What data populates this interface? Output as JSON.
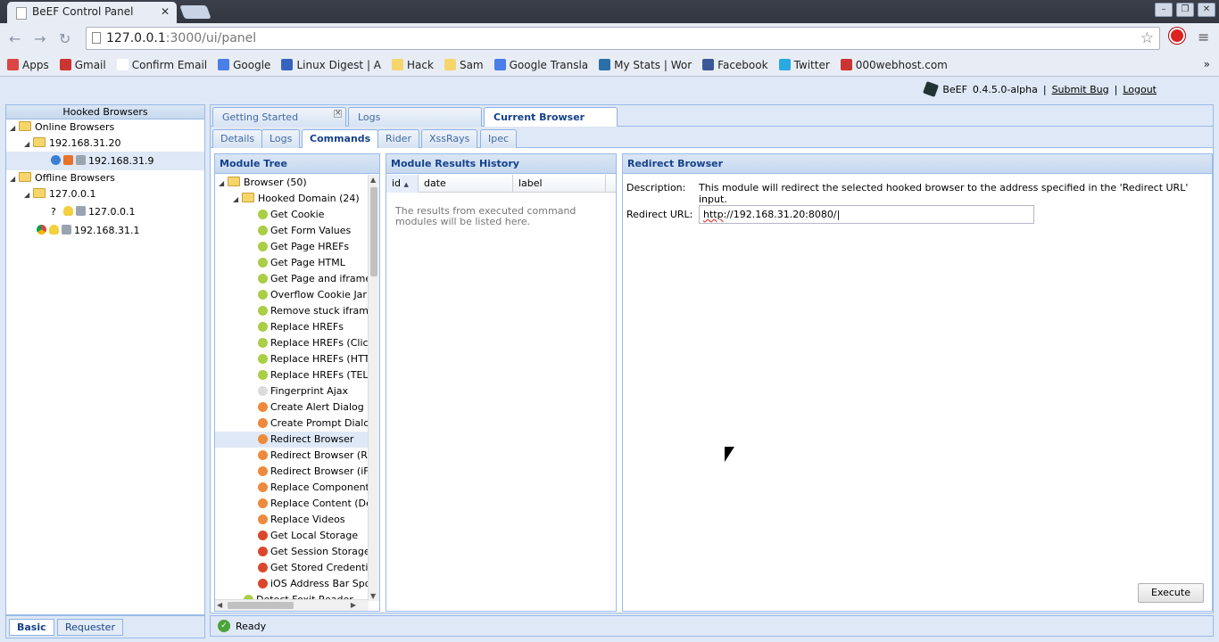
{
  "browser": {
    "tab_title": "BeEF Control Panel",
    "url_main": "127.0.0.1",
    "url_rest": ":3000/ui/panel",
    "bookmarks": [
      {
        "label": "Apps",
        "color": "#d44"
      },
      {
        "label": "Gmail",
        "color": "#c33"
      },
      {
        "label": "Confirm Email",
        "color": "#fff"
      },
      {
        "label": "Google",
        "color": "#4a7ee8"
      },
      {
        "label": "Linux Digest | A",
        "color": "#3763c0"
      },
      {
        "label": "Hack",
        "color": "#f6d56a"
      },
      {
        "label": "Sam",
        "color": "#f6d56a"
      },
      {
        "label": "Google Transla",
        "color": "#4a7ee8"
      },
      {
        "label": "My Stats | Wor",
        "color": "#2b6fa8"
      },
      {
        "label": "Facebook",
        "color": "#3b5998"
      },
      {
        "label": "Twitter",
        "color": "#29a9e1"
      },
      {
        "label": "000webhost.com",
        "color": "#c33"
      }
    ]
  },
  "topnav": {
    "brand": "BeEF",
    "version": "0.4.5.0-alpha",
    "submit_bug": "Submit Bug",
    "logout": "Logout"
  },
  "hooked": {
    "title": "Hooked Browsers",
    "online_label": "Online Browsers",
    "online_host": "192.168.31.20",
    "online_browser": "192.168.31.9",
    "offline_label": "Offline Browsers",
    "offline_host": "127.0.0.1",
    "offline_browser_1": "127.0.0.1",
    "offline_browser_1_icon": "?",
    "offline_browser_2": "192.168.31.1"
  },
  "bottom_tabs": {
    "basic": "Basic",
    "requester": "Requester"
  },
  "main_tabs": {
    "getting_started": "Getting Started",
    "logs": "Logs",
    "current_browser": "Current Browser"
  },
  "sub_tabs": {
    "details": "Details",
    "logs": "Logs",
    "commands": "Commands",
    "rider": "Rider",
    "xssrays": "XssRays",
    "ipec": "Ipec"
  },
  "module_tree": {
    "title": "Module Tree",
    "browser_folder": "Browser (50)",
    "hooked_domain_folder": "Hooked Domain (24)",
    "items": [
      {
        "label": "Get Cookie",
        "color": "#a8cf45"
      },
      {
        "label": "Get Form Values",
        "color": "#a8cf45"
      },
      {
        "label": "Get Page HREFs",
        "color": "#a8cf45"
      },
      {
        "label": "Get Page HTML",
        "color": "#a8cf45"
      },
      {
        "label": "Get Page and iframe H",
        "color": "#a8cf45"
      },
      {
        "label": "Overflow Cookie Jar",
        "color": "#a8cf45"
      },
      {
        "label": "Remove stuck iframe",
        "color": "#a8cf45"
      },
      {
        "label": "Replace HREFs",
        "color": "#a8cf45"
      },
      {
        "label": "Replace HREFs (Click I",
        "color": "#a8cf45"
      },
      {
        "label": "Replace HREFs (HTTPS",
        "color": "#a8cf45"
      },
      {
        "label": "Replace HREFs (TEL)",
        "color": "#a8cf45"
      },
      {
        "label": "Fingerprint Ajax",
        "color": "#dcdcdc"
      },
      {
        "label": "Create Alert Dialog",
        "color": "#ee8a3c"
      },
      {
        "label": "Create Prompt Dialog",
        "color": "#ee8a3c"
      },
      {
        "label": "Redirect Browser",
        "color": "#ee8a3c"
      },
      {
        "label": "Redirect Browser (Ric",
        "color": "#ee8a3c"
      },
      {
        "label": "Redirect Browser (iFra",
        "color": "#ee8a3c"
      },
      {
        "label": "Replace Component (D",
        "color": "#ee8a3c"
      },
      {
        "label": "Replace Content (Defa",
        "color": "#ee8a3c"
      },
      {
        "label": "Replace Videos",
        "color": "#ee8a3c"
      },
      {
        "label": "Get Local Storage",
        "color": "#d9482b"
      },
      {
        "label": "Get Session Storage",
        "color": "#d9482b"
      },
      {
        "label": "Get Stored Credentials",
        "color": "#d9482b"
      },
      {
        "label": "iOS Address Bar Spoo",
        "color": "#d9482b"
      }
    ],
    "trailing_item": "Detect Foxit Reader",
    "trailing_color": "#a8cf45"
  },
  "results": {
    "title": "Module Results History",
    "col_id": "id",
    "col_date": "date",
    "col_label": "label",
    "empty_text": "The results from executed command modules will be listed here."
  },
  "detail": {
    "title": "Redirect Browser",
    "description_label": "Description:",
    "description": "This module will redirect the selected hooked browser to the address specified in the 'Redirect URL' input.",
    "url_label": "Redirect URL:",
    "url_value_spelled": "http",
    "url_value_rest": "://192.168.31.20:8080/",
    "execute": "Execute"
  },
  "status": {
    "text": "Ready"
  }
}
